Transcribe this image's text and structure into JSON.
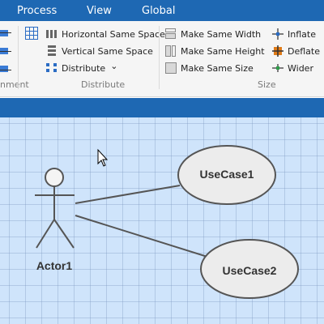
{
  "menu": {
    "items": [
      "Process",
      "View",
      "Global"
    ]
  },
  "ribbon": {
    "arrange_group_label_partial": "nment",
    "distribute": {
      "horizontal": "Horizontal Same Space",
      "vertical": "Vertical Same Space",
      "distribute": "Distribute",
      "dropdown_arrow": "⌄",
      "label": "Distribute"
    },
    "size": {
      "width": "Make Same Width",
      "height": "Make Same Height",
      "size": "Make Same Size",
      "inflate": "Inflate",
      "deflate": "Deflate",
      "wider": "Wider",
      "label": "Size"
    }
  },
  "diagram": {
    "actor": "Actor1",
    "use_cases": [
      "UseCase1",
      "UseCase2"
    ]
  },
  "colors": {
    "menubar": "#1e68b3",
    "canvas": "#cfe4fb",
    "use_case_fill": "#ececec",
    "stroke": "#555555"
  }
}
